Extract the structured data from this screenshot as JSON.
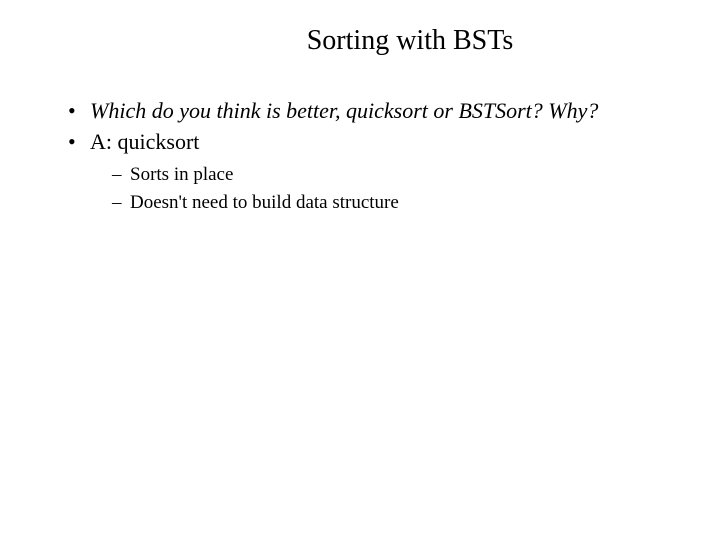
{
  "title": "Sorting with BSTs",
  "bullets": [
    {
      "text": "Which do you think is better, quicksort or BSTSort?  Why?",
      "italic": true
    },
    {
      "text": "A: quicksort",
      "italic": false
    }
  ],
  "subbullets": [
    {
      "text": "Sorts in place"
    },
    {
      "text": "Doesn't need to build data structure"
    }
  ]
}
